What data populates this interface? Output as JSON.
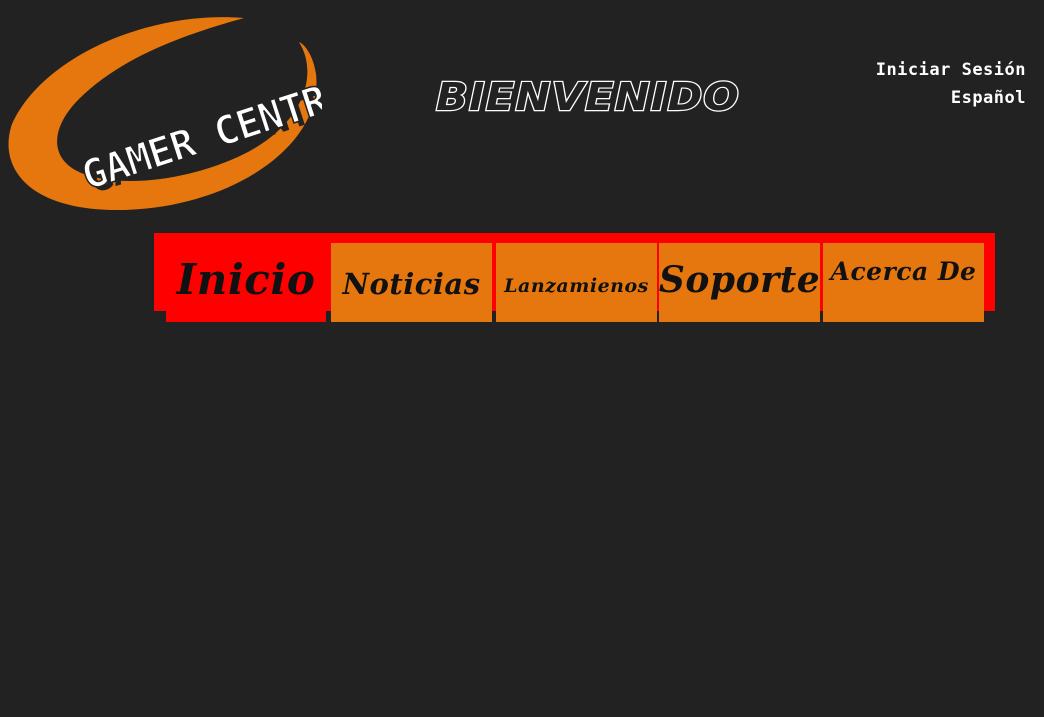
{
  "logo": {
    "text": "GAMER CENTRAL",
    "ring_color": "#e5770e"
  },
  "header": {
    "welcome": "BIENVENIDO"
  },
  "top_links": {
    "login": "Iniciar Sesión",
    "language": "Español"
  },
  "nav": {
    "bar_color": "#ff0000",
    "tab_color": "#e5770e",
    "items": [
      {
        "label": "Inicio",
        "active": true
      },
      {
        "label": "Noticias",
        "active": false
      },
      {
        "label": "Lanzamienos",
        "active": false
      },
      {
        "label": "Soporte",
        "active": false
      },
      {
        "label": "Acerca De",
        "active": false
      }
    ]
  },
  "colors": {
    "background": "#222222",
    "text": "#ffffff"
  }
}
